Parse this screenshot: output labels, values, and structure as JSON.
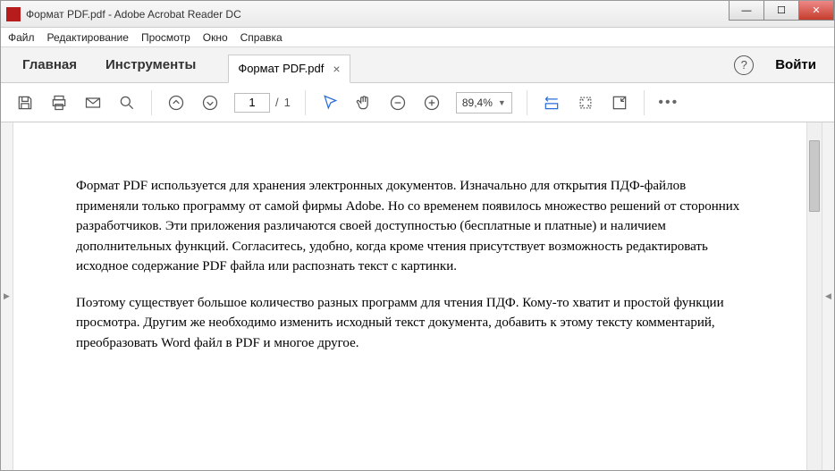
{
  "titlebar": {
    "title": "Формат PDF.pdf - Adobe Acrobat Reader DC"
  },
  "menu": {
    "file": "Файл",
    "edit": "Редактирование",
    "view": "Просмотр",
    "window": "Окно",
    "help": "Справка"
  },
  "tabs": {
    "home": "Главная",
    "tools": "Инструменты",
    "doc": "Формат PDF.pdf",
    "login": "Войти",
    "help": "?"
  },
  "toolbar": {
    "page_current": "1",
    "page_sep": "/",
    "page_total": "1",
    "zoom": "89,4%"
  },
  "document": {
    "para1": "Формат PDF используется для хранения электронных документов. Изначально для открытия ПДФ-файлов применяли только программу от самой фирмы Adobe. Но со временем появилось множество решений от сторонних разработчиков. Эти приложения различаются своей доступностью (бесплатные и платные) и наличием дополнительных функций. Согласитесь, удобно, когда кроме чтения присутствует возможность редактировать исходное содержание PDF файла или распознать текст с картинки.",
    "para2": "Поэтому существует большое количество разных программ для чтения ПДФ. Кому-то хватит и простой функции просмотра. Другим же необходимо изменить исходный текст документа, добавить к этому тексту комментарий, преобразовать Word файл в PDF и многое другое."
  }
}
